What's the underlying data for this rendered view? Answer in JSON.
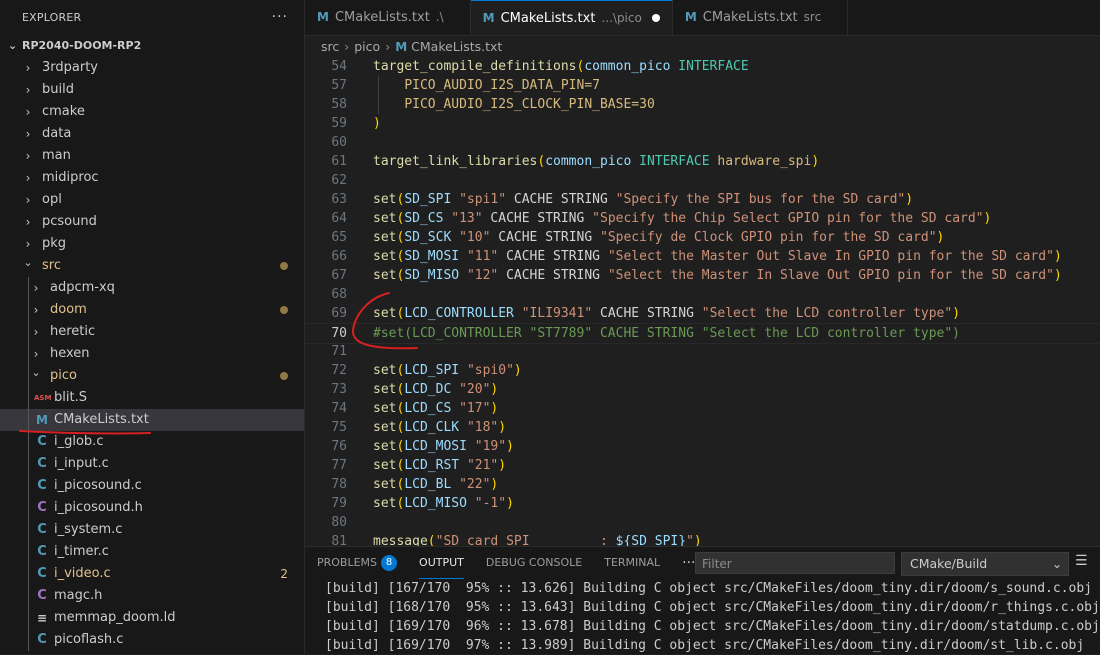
{
  "explorer": {
    "title": "EXPLORER",
    "more": "···",
    "root": "RP2040-DOOM-RP2",
    "items": [
      {
        "label": "3rdparty",
        "type": "folder",
        "open": false,
        "depth": 1
      },
      {
        "label": "build",
        "type": "folder",
        "open": false,
        "depth": 1
      },
      {
        "label": "cmake",
        "type": "folder",
        "open": false,
        "depth": 1
      },
      {
        "label": "data",
        "type": "folder",
        "open": false,
        "depth": 1
      },
      {
        "label": "man",
        "type": "folder",
        "open": false,
        "depth": 1
      },
      {
        "label": "midiproc",
        "type": "folder",
        "open": false,
        "depth": 1
      },
      {
        "label": "opl",
        "type": "folder",
        "open": false,
        "depth": 1
      },
      {
        "label": "pcsound",
        "type": "folder",
        "open": false,
        "depth": 1
      },
      {
        "label": "pkg",
        "type": "folder",
        "open": false,
        "depth": 1
      },
      {
        "label": "src",
        "type": "folder",
        "open": true,
        "depth": 1,
        "modified": true,
        "dot": true
      },
      {
        "label": "adpcm-xq",
        "type": "folder",
        "open": false,
        "depth": 2
      },
      {
        "label": "doom",
        "type": "folder",
        "open": false,
        "depth": 2,
        "modified": true,
        "dot": true
      },
      {
        "label": "heretic",
        "type": "folder",
        "open": false,
        "depth": 2
      },
      {
        "label": "hexen",
        "type": "folder",
        "open": false,
        "depth": 2
      },
      {
        "label": "pico",
        "type": "folder",
        "open": true,
        "depth": 2,
        "modified": true,
        "dot": true
      },
      {
        "label": "blit.S",
        "type": "file",
        "icon": "asm",
        "depth": 3
      },
      {
        "label": "CMakeLists.txt",
        "type": "file",
        "icon": "m",
        "depth": 3,
        "selected": true
      },
      {
        "label": "i_glob.c",
        "type": "file",
        "icon": "c",
        "depth": 3
      },
      {
        "label": "i_input.c",
        "type": "file",
        "icon": "c",
        "depth": 3
      },
      {
        "label": "i_picosound.c",
        "type": "file",
        "icon": "c",
        "depth": 3
      },
      {
        "label": "i_picosound.h",
        "type": "file",
        "icon": "h",
        "depth": 3
      },
      {
        "label": "i_system.c",
        "type": "file",
        "icon": "c",
        "depth": 3
      },
      {
        "label": "i_timer.c",
        "type": "file",
        "icon": "c",
        "depth": 3
      },
      {
        "label": "i_video.c",
        "type": "file",
        "icon": "c",
        "depth": 3,
        "modified": true,
        "count": "2"
      },
      {
        "label": "magc.h",
        "type": "file",
        "icon": "h",
        "depth": 3
      },
      {
        "label": "memmap_doom.ld",
        "type": "file",
        "icon": "ld",
        "depth": 3
      },
      {
        "label": "picoflash.c",
        "type": "file",
        "icon": "c",
        "depth": 3
      }
    ]
  },
  "tabs": [
    {
      "label": "CMakeLists.txt",
      "desc": ".\\",
      "active": false,
      "dirty": false
    },
    {
      "label": "CMakeLists.txt",
      "desc": "...\\pico",
      "active": true,
      "dirty": true
    },
    {
      "label": "CMakeLists.txt",
      "desc": "src",
      "active": false,
      "dirty": false
    }
  ],
  "breadcrumb": [
    "src",
    "pico",
    "CMakeLists.txt"
  ],
  "editor": {
    "current_line": 70,
    "lines": [
      {
        "n": "54",
        "tokens": [
          [
            "fn",
            "target_compile_definitions"
          ],
          [
            "pu",
            "("
          ],
          [
            "vr",
            "common_pico"
          ],
          [
            "tx",
            " "
          ],
          [
            "kw",
            "INTERFACE"
          ]
        ]
      },
      {
        "n": "57",
        "indent": true,
        "tokens": [
          [
            "tx",
            "    "
          ],
          [
            "mc",
            "PICO_AUDIO_I2S_DATA_PIN=7"
          ]
        ]
      },
      {
        "n": "58",
        "indent": true,
        "tokens": [
          [
            "tx",
            "    "
          ],
          [
            "mc",
            "PICO_AUDIO_I2S_CLOCK_PIN_BASE=30"
          ]
        ]
      },
      {
        "n": "59",
        "tokens": [
          [
            "pu",
            ")"
          ]
        ]
      },
      {
        "n": "60",
        "tokens": []
      },
      {
        "n": "61",
        "tokens": [
          [
            "fn",
            "target_link_libraries"
          ],
          [
            "pu",
            "("
          ],
          [
            "vr",
            "common_pico"
          ],
          [
            "tx",
            " "
          ],
          [
            "kw",
            "INTERFACE"
          ],
          [
            "tx",
            " "
          ],
          [
            "mc",
            "hardware_spi"
          ],
          [
            "pu",
            ")"
          ]
        ]
      },
      {
        "n": "62",
        "tokens": []
      },
      {
        "n": "63",
        "tokens": [
          [
            "fn",
            "set"
          ],
          [
            "pu",
            "("
          ],
          [
            "vr",
            "SD_SPI"
          ],
          [
            "tx",
            " "
          ],
          [
            "st",
            "\"spi1\""
          ],
          [
            "tx",
            " CACHE STRING "
          ],
          [
            "st",
            "\"Specify the SPI bus for the SD card\""
          ],
          [
            "pu",
            ")"
          ]
        ]
      },
      {
        "n": "64",
        "tokens": [
          [
            "fn",
            "set"
          ],
          [
            "pu",
            "("
          ],
          [
            "vr",
            "SD_CS"
          ],
          [
            "tx",
            " "
          ],
          [
            "st",
            "\"13\""
          ],
          [
            "tx",
            " CACHE STRING "
          ],
          [
            "st",
            "\"Specify the Chip Select GPIO pin for the SD card\""
          ],
          [
            "pu",
            ")"
          ]
        ]
      },
      {
        "n": "65",
        "tokens": [
          [
            "fn",
            "set"
          ],
          [
            "pu",
            "("
          ],
          [
            "vr",
            "SD_SCK"
          ],
          [
            "tx",
            " "
          ],
          [
            "st",
            "\"10\""
          ],
          [
            "tx",
            " CACHE STRING "
          ],
          [
            "st",
            "\"Specify de Clock GPIO pin for the SD card\""
          ],
          [
            "pu",
            ")"
          ]
        ]
      },
      {
        "n": "66",
        "tokens": [
          [
            "fn",
            "set"
          ],
          [
            "pu",
            "("
          ],
          [
            "vr",
            "SD_MOSI"
          ],
          [
            "tx",
            " "
          ],
          [
            "st",
            "\"11\""
          ],
          [
            "tx",
            " CACHE STRING "
          ],
          [
            "st",
            "\"Select the Master Out Slave In GPIO pin for the SD card\""
          ],
          [
            "pu",
            ")"
          ]
        ]
      },
      {
        "n": "67",
        "tokens": [
          [
            "fn",
            "set"
          ],
          [
            "pu",
            "("
          ],
          [
            "vr",
            "SD_MISO"
          ],
          [
            "tx",
            " "
          ],
          [
            "st",
            "\"12\""
          ],
          [
            "tx",
            " CACHE STRING "
          ],
          [
            "st",
            "\"Select the Master In Slave Out GPIO pin for the SD card\""
          ],
          [
            "pu",
            ")"
          ]
        ]
      },
      {
        "n": "68",
        "tokens": []
      },
      {
        "n": "69",
        "tokens": [
          [
            "fn",
            "set"
          ],
          [
            "pu",
            "("
          ],
          [
            "vr",
            "LCD_CONTROLLER"
          ],
          [
            "tx",
            " "
          ],
          [
            "st",
            "\"ILI9341\""
          ],
          [
            "tx",
            " CACHE STRING "
          ],
          [
            "st",
            "\"Select the LCD controller type\""
          ],
          [
            "pu",
            ")"
          ]
        ]
      },
      {
        "n": "70",
        "tokens": [
          [
            "cm",
            "#set(LCD_CONTROLLER \"ST7789\" CACHE STRING \"Select the LCD controller type\")"
          ]
        ]
      },
      {
        "n": "71",
        "tokens": []
      },
      {
        "n": "72",
        "tokens": [
          [
            "fn",
            "set"
          ],
          [
            "pu",
            "("
          ],
          [
            "vr",
            "LCD_SPI"
          ],
          [
            "tx",
            " "
          ],
          [
            "st",
            "\"spi0\""
          ],
          [
            "pu",
            ")"
          ]
        ]
      },
      {
        "n": "73",
        "tokens": [
          [
            "fn",
            "set"
          ],
          [
            "pu",
            "("
          ],
          [
            "vr",
            "LCD_DC"
          ],
          [
            "tx",
            " "
          ],
          [
            "st",
            "\"20\""
          ],
          [
            "pu",
            ")"
          ]
        ]
      },
      {
        "n": "74",
        "tokens": [
          [
            "fn",
            "set"
          ],
          [
            "pu",
            "("
          ],
          [
            "vr",
            "LCD_CS"
          ],
          [
            "tx",
            " "
          ],
          [
            "st",
            "\"17\""
          ],
          [
            "pu",
            ")"
          ]
        ]
      },
      {
        "n": "75",
        "tokens": [
          [
            "fn",
            "set"
          ],
          [
            "pu",
            "("
          ],
          [
            "vr",
            "LCD_CLK"
          ],
          [
            "tx",
            " "
          ],
          [
            "st",
            "\"18\""
          ],
          [
            "pu",
            ")"
          ]
        ]
      },
      {
        "n": "76",
        "tokens": [
          [
            "fn",
            "set"
          ],
          [
            "pu",
            "("
          ],
          [
            "vr",
            "LCD_MOSI"
          ],
          [
            "tx",
            " "
          ],
          [
            "st",
            "\"19\""
          ],
          [
            "pu",
            ")"
          ]
        ]
      },
      {
        "n": "77",
        "tokens": [
          [
            "fn",
            "set"
          ],
          [
            "pu",
            "("
          ],
          [
            "vr",
            "LCD_RST"
          ],
          [
            "tx",
            " "
          ],
          [
            "st",
            "\"21\""
          ],
          [
            "pu",
            ")"
          ]
        ]
      },
      {
        "n": "78",
        "tokens": [
          [
            "fn",
            "set"
          ],
          [
            "pu",
            "("
          ],
          [
            "vr",
            "LCD_BL"
          ],
          [
            "tx",
            " "
          ],
          [
            "st",
            "\"22\""
          ],
          [
            "pu",
            ")"
          ]
        ]
      },
      {
        "n": "79",
        "tokens": [
          [
            "fn",
            "set"
          ],
          [
            "pu",
            "("
          ],
          [
            "vr",
            "LCD_MISO"
          ],
          [
            "tx",
            " "
          ],
          [
            "st",
            "\"-1\""
          ],
          [
            "pu",
            ")"
          ]
        ]
      },
      {
        "n": "80",
        "tokens": []
      },
      {
        "n": "81",
        "tokens": [
          [
            "fn",
            "message"
          ],
          [
            "pu",
            "("
          ],
          [
            "st",
            "\"SD card SPI         : "
          ],
          [
            "vr",
            "${SD_SPI}"
          ],
          [
            "st",
            "\""
          ],
          [
            "pu",
            ")"
          ]
        ]
      }
    ]
  },
  "panel": {
    "tabs": [
      {
        "label": "PROBLEMS",
        "badge": "8",
        "active": false
      },
      {
        "label": "OUTPUT",
        "active": true
      },
      {
        "label": "DEBUG CONSOLE",
        "active": false
      },
      {
        "label": "TERMINAL",
        "active": false
      }
    ],
    "more": "···",
    "filter_placeholder": "Filter",
    "channel": "CMake/Build",
    "menu_icon": "☰",
    "output_lines": [
      "[build] [167/170  95% :: 13.626] Building C object src/CMakeFiles/doom_tiny.dir/doom/s_sound.c.obj",
      "[build] [168/170  95% :: 13.643] Building C object src/CMakeFiles/doom_tiny.dir/doom/r_things.c.obj",
      "[build] [169/170  96% :: 13.678] Building C object src/CMakeFiles/doom_tiny.dir/doom/statdump.c.obj",
      "[build] [169/170  97% :: 13.989] Building C object src/CMakeFiles/doom_tiny.dir/doom/st_lib.c.obj"
    ]
  },
  "colors": {
    "accent": "#0078d4",
    "annotation": "#d42020",
    "modified": "#e2c08d"
  }
}
